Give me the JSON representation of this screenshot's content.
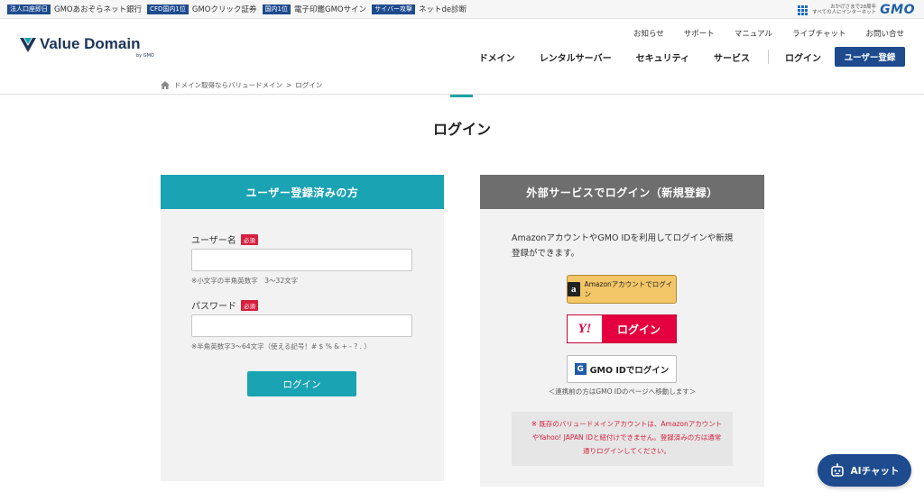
{
  "gmo_bar": {
    "items": [
      {
        "badge": "法人口座即日",
        "text": "GMOあおぞらネット銀行"
      },
      {
        "badge": "CFD国内1位",
        "text": "GMOクリック証券"
      },
      {
        "badge": "国内1位",
        "text": "電子印鑑GMOサイン"
      },
      {
        "badge": "サイバー攻撃",
        "text": "ネットde診断"
      }
    ],
    "tagline_line1": "おかげさまで28周年",
    "tagline_line2": "すべての人にインターネット",
    "logo": "GMO"
  },
  "header": {
    "logo_text": "Value Domain",
    "logo_by": "by GMO",
    "subnav": [
      "お知らせ",
      "サポート",
      "マニュアル",
      "ライブチャット",
      "お問い合せ"
    ],
    "mainnav": [
      "ドメイン",
      "レンタルサーバー",
      "セキュリティ",
      "サービス"
    ],
    "login": "ログイン",
    "register": "ユーザー登録"
  },
  "breadcrumb": {
    "home": "ドメイン取得ならバリュードメイン",
    "sep": ">",
    "current": "ログイン"
  },
  "page_title": "ログイン",
  "left_panel": {
    "heading": "ユーザー登録済みの方",
    "username_label": "ユーザー名",
    "required": "必須",
    "username_value": "",
    "username_hint": "※小文字の半角英数字　3〜32文字",
    "password_label": "パスワード",
    "password_value": "",
    "password_hint": "※半角英数字3〜64文字（使える記号！# $ % & + - ? . ）",
    "login_button": "ログイン"
  },
  "right_panel": {
    "heading": "外部サービスでログイン（新規登録）",
    "description": "AmazonアカウントやGMO IDを利用してログインや新規登録ができます。",
    "amazon_button": "Amazonアカウントでログイン",
    "yahoo_mark": "Y!",
    "yahoo_button": "ログイン",
    "gmo_mark": "G",
    "gmo_button": "GMO IDでログイン",
    "gmo_note": "＜連携前の方はGMO IDのページへ移動します＞",
    "warning": "※ 既存のバリュードメインアカウントは、AmazonアカウントやYahoo! JAPAN IDと紐付けできません。登録済みの方は通常通りログインしてください。"
  },
  "chat_button": "AIチャット",
  "colors": {
    "teal": "#1aa3b3",
    "navy": "#1e4b8e",
    "required_red": "#d6203e",
    "yahoo_red": "#e5003f",
    "amazon_gold": "#f3c668"
  }
}
